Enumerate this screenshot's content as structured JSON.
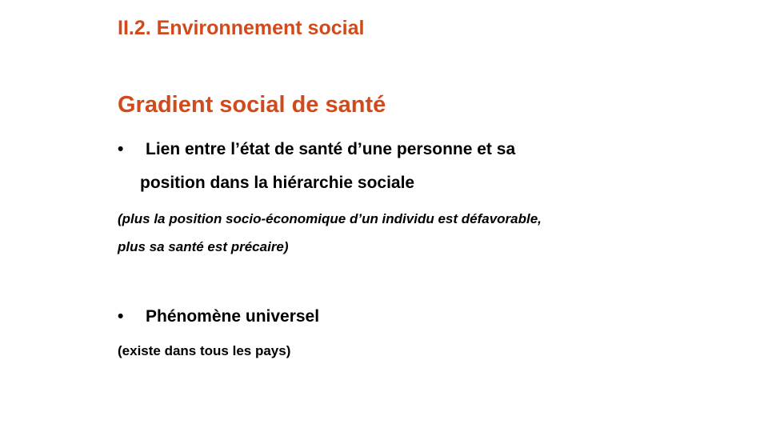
{
  "slide": {
    "section_title": "II.2. Environnement social",
    "heading": "Gradient social de santé",
    "bullets": [
      {
        "marker": "•",
        "line1": "Lien entre l’état de santé d’une personne et sa",
        "line2": "position dans la hiérarchie sociale",
        "note_line1": "(plus la position socio-économique  d’un individu est défavorable,",
        "note_line2": "plus sa santé est précaire)"
      },
      {
        "marker": "•",
        "line1": "Phénomène universel",
        "note_line1": "(existe dans tous les pays)"
      }
    ],
    "colors": {
      "accent": "#d24a1b",
      "text": "#000000",
      "background": "#ffffff"
    }
  }
}
